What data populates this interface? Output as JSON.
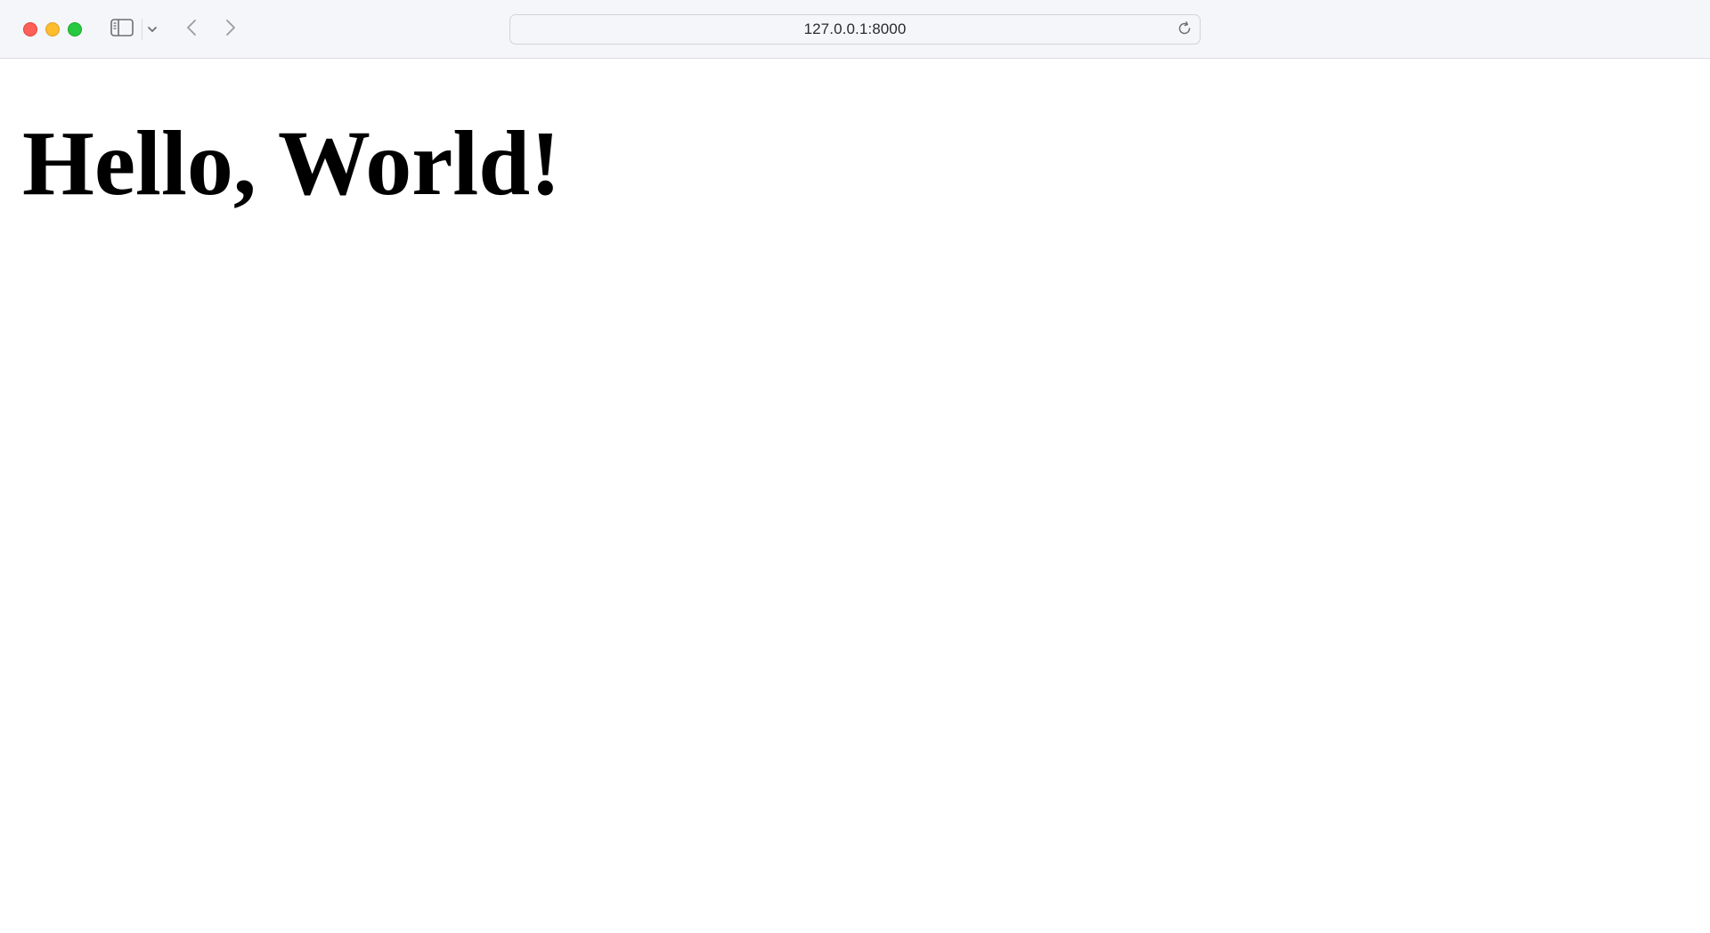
{
  "browser": {
    "address": "127.0.0.1:8000",
    "controls": {
      "close_color": "#fe5f57",
      "minimize_color": "#febc2e",
      "maximize_color": "#28c840"
    },
    "icons": [
      "sidebar-icon",
      "chevron-down-icon",
      "back-arrow-icon",
      "forward-arrow-icon",
      "reload-icon"
    ]
  },
  "page": {
    "heading": "Hello, World!"
  }
}
